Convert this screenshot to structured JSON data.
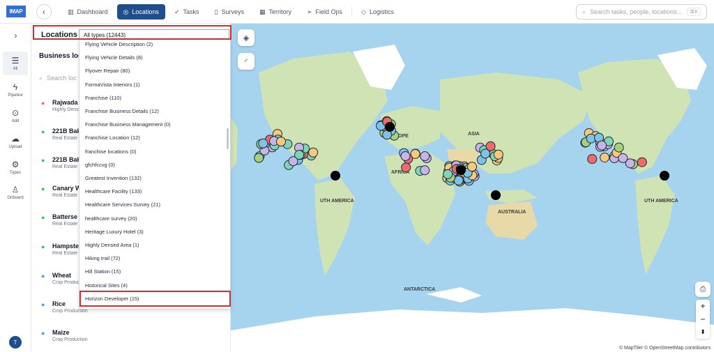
{
  "app": {
    "logo_text": "IMAP"
  },
  "nav": [
    {
      "label": "Dashboard",
      "icon": "chart-icon"
    },
    {
      "label": "Locations",
      "icon": "location-pin-icon",
      "active": true
    },
    {
      "label": "Tasks",
      "icon": "check-icon"
    },
    {
      "label": "Surveys",
      "icon": "clipboard-icon"
    },
    {
      "label": "Territory",
      "icon": "map-icon"
    },
    {
      "label": "Field Ops",
      "icon": "send-icon"
    },
    {
      "label": "Logistics",
      "icon": "box-icon"
    }
  ],
  "search": {
    "placeholder": "Search tasks, people, locations...",
    "shortcut": "⌘K"
  },
  "rail": [
    {
      "label": "All",
      "icon": "list-icon",
      "active": true
    },
    {
      "label": "Pipeline",
      "icon": "bolt-icon"
    },
    {
      "label": "Add",
      "icon": "pin-add-icon"
    },
    {
      "label": "Upload",
      "icon": "upload-icon"
    },
    {
      "label": "Types",
      "icon": "gear-icon"
    },
    {
      "label": "Onboard",
      "icon": "user-add-icon"
    }
  ],
  "user": {
    "initial": "T"
  },
  "panel": {
    "title": "Locations",
    "selected_type": "All types (12443)",
    "subtitle": "Business loc",
    "search_placeholder": "Search loc",
    "items": [
      {
        "name": "Rajwada I",
        "category": "Highly Dens",
        "pin_color": "#ef6b6b"
      },
      {
        "name": "221B Bak",
        "category": "Real Estate",
        "pin_color": "#34c759"
      },
      {
        "name": "221B Bak",
        "category": "Real Estate",
        "pin_color": "#34c759"
      },
      {
        "name": "Canary W",
        "category": "Real Estate",
        "pin_color": "#34c759"
      },
      {
        "name": "Batterse",
        "category": "Real Estate",
        "pin_color": "#34c759"
      },
      {
        "name": "Hampste",
        "category": "Real Estate",
        "pin_color": "#34c759"
      },
      {
        "name": "Wheat",
        "category": "Crop Production",
        "pin_color": "#4a9fd8"
      },
      {
        "name": "Rice",
        "category": "Crop Production",
        "pin_color": "#4a9fd8"
      },
      {
        "name": "Maize",
        "category": "Crop Production",
        "pin_color": "#4a9fd8"
      }
    ]
  },
  "dropdown": {
    "options": [
      "Flying Vehicle Description (2)",
      "Flying Vehicle Details (8)",
      "Flyover Repair (80)",
      "FormaVista Interiors (1)",
      "Franchise (110)",
      "Franchise Business Details (12)",
      "Franchise Business Management (0)",
      "Franchise Location (12)",
      "franchise locations (0)",
      "gfchfccvg (0)",
      "Greatest Invention (132)",
      "Healthcare Facility (133)",
      "Healthcare Services Survey (21)",
      "healthcare survey (20)",
      "Heritage Luxury Hotel (3)",
      "Highly Densed Area (1)",
      "Hiking trail (72)",
      "Hill Station (15)",
      "Historical Sites (4)",
      "Horizon Developer (15)"
    ],
    "highlighted": "Horizon Developer (15)"
  },
  "map": {
    "labels": [
      "ASIA",
      "AFRICA",
      "UTH AMERICA",
      "AUSTRALIA",
      "ANTARCTICA",
      "ROPE",
      "UTH AMERICA"
    ],
    "attribution": "© MapTiler © OpenStreetMap contributors",
    "zoom_in": "+",
    "zoom_out": "−",
    "colors": {
      "ocean": "#a6d3ee",
      "land": "#cfe3b5",
      "ice": "#ffffff",
      "marker_stroke": "#1f2937"
    }
  }
}
